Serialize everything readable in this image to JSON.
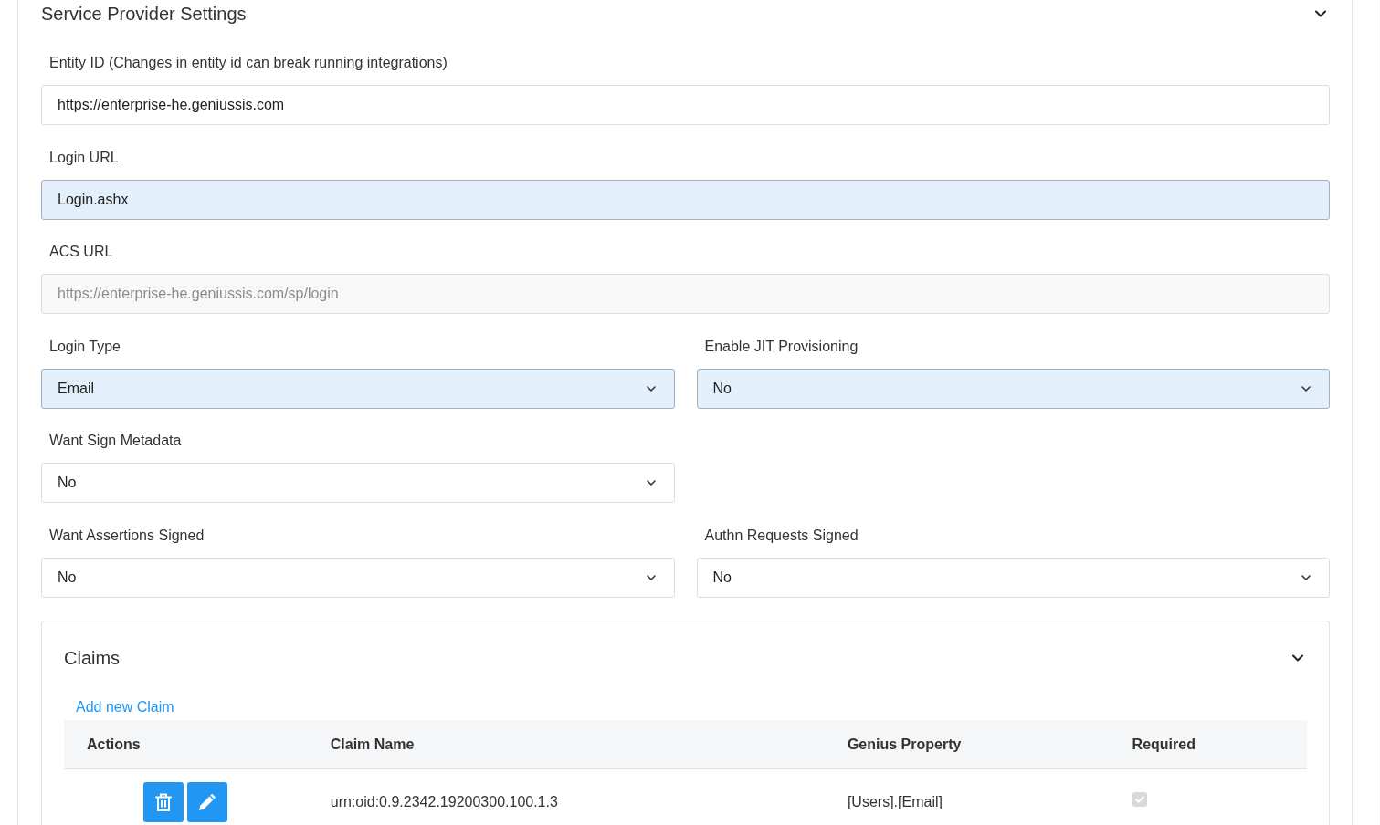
{
  "section": {
    "title": "Service Provider Settings",
    "expanded": true
  },
  "wide_fields": [
    {
      "kind": "text",
      "label": "Entity ID (Changes in entity id can break running integrations)",
      "value": "https://enterprise-he.geniussis.com",
      "highlighted": false,
      "disabled": false
    },
    {
      "kind": "text",
      "label": "Login URL",
      "value": "Login.ashx",
      "highlighted": true,
      "disabled": false
    },
    {
      "kind": "text",
      "label": "ACS URL",
      "value": "https://enterprise-he.geniussis.com/sp/login",
      "highlighted": false,
      "disabled": true
    }
  ],
  "paired_rows": [
    [
      {
        "kind": "select",
        "label": "Login Type",
        "value": "Email",
        "highlighted": true,
        "disabled": false
      },
      {
        "kind": "select",
        "label": "Enable JIT Provisioning",
        "value": "No",
        "highlighted": true,
        "disabled": false
      }
    ],
    [
      {
        "kind": "select",
        "label": "Want Sign Metadata",
        "value": "No",
        "highlighted": false,
        "disabled": false
      }
    ],
    [
      {
        "kind": "select",
        "label": "Want Assertions Signed",
        "value": "No",
        "highlighted": false,
        "disabled": false
      },
      {
        "kind": "select",
        "label": "Authn Requests Signed",
        "value": "No",
        "highlighted": false,
        "disabled": false
      }
    ]
  ],
  "claims": {
    "title": "Claims",
    "expanded": true,
    "add_link": "Add new Claim",
    "columns": [
      "Actions",
      "Claim Name",
      "Genius Property",
      "Required"
    ],
    "rows": [
      {
        "claim_name": "urn:oid:0.9.2342.19200300.100.1.3",
        "genius_property": "[Users].[Email]",
        "required": true,
        "disabled": true
      }
    ]
  }
}
